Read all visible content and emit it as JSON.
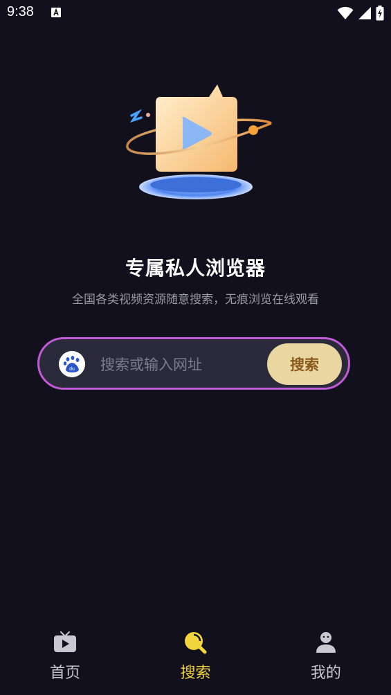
{
  "status_bar": {
    "time": "9:38"
  },
  "main": {
    "title": "专属私人浏览器",
    "subtitle": "全国各类视频资源随意搜索，无痕浏览在线观看"
  },
  "search": {
    "placeholder": "搜索或输入网址",
    "value": "",
    "engine_icon": "baidu-paw-icon",
    "button_label": "搜索",
    "border_color": "#c05ad6",
    "button_color": "#ead6a1"
  },
  "bottom_nav": {
    "items": [
      {
        "label": "首页",
        "icon": "tv-play-icon",
        "active": false
      },
      {
        "label": "搜索",
        "icon": "search-icon",
        "active": true
      },
      {
        "label": "我的",
        "icon": "profile-icon",
        "active": false
      }
    ],
    "active_color": "#f2d43c"
  }
}
